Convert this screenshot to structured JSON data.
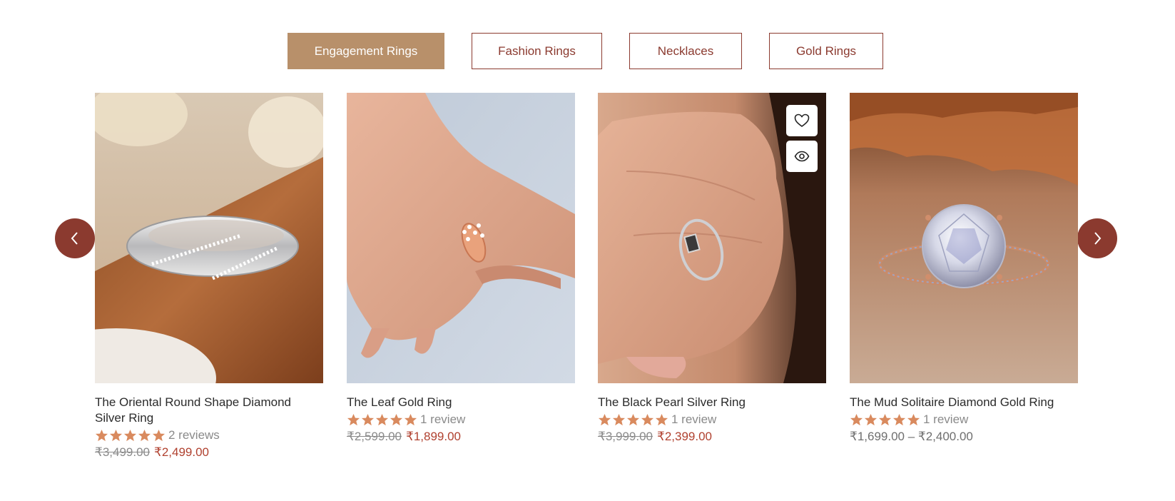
{
  "tabs": [
    {
      "label": "Engagement Rings",
      "active": true
    },
    {
      "label": "Fashion Rings",
      "active": false
    },
    {
      "label": "Necklaces",
      "active": false
    },
    {
      "label": "Gold Rings",
      "active": false
    }
  ],
  "products": [
    {
      "name": "The Oriental Round Shape Diamond Silver Ring",
      "rating": 5,
      "reviews": "2 reviews",
      "price_old": "₹3,499.00",
      "price_new": "₹2,499.00"
    },
    {
      "name": "The Leaf Gold Ring",
      "rating": 5,
      "reviews": "1 review",
      "price_old": "₹2,599.00",
      "price_new": "₹1,899.00"
    },
    {
      "name": "The Black Pearl Silver Ring",
      "rating": 5,
      "reviews": "1 review",
      "price_old": "₹3,999.00",
      "price_new": "₹2,399.00"
    },
    {
      "name": "The Mud Solitaire Diamond Gold Ring",
      "rating": 5,
      "reviews": "1 review",
      "price_range": "₹1,699.00 – ₹2,400.00"
    }
  ],
  "icons": {
    "prev": "chevron-left-icon",
    "next": "chevron-right-icon",
    "wishlist": "heart-icon",
    "quick_view": "eye-icon",
    "star": "star-icon"
  },
  "colors": {
    "brand": "#8b3a2f",
    "tab_active": "#b8906a",
    "star": "#d98a5e",
    "sale_price": "#b0412f"
  }
}
